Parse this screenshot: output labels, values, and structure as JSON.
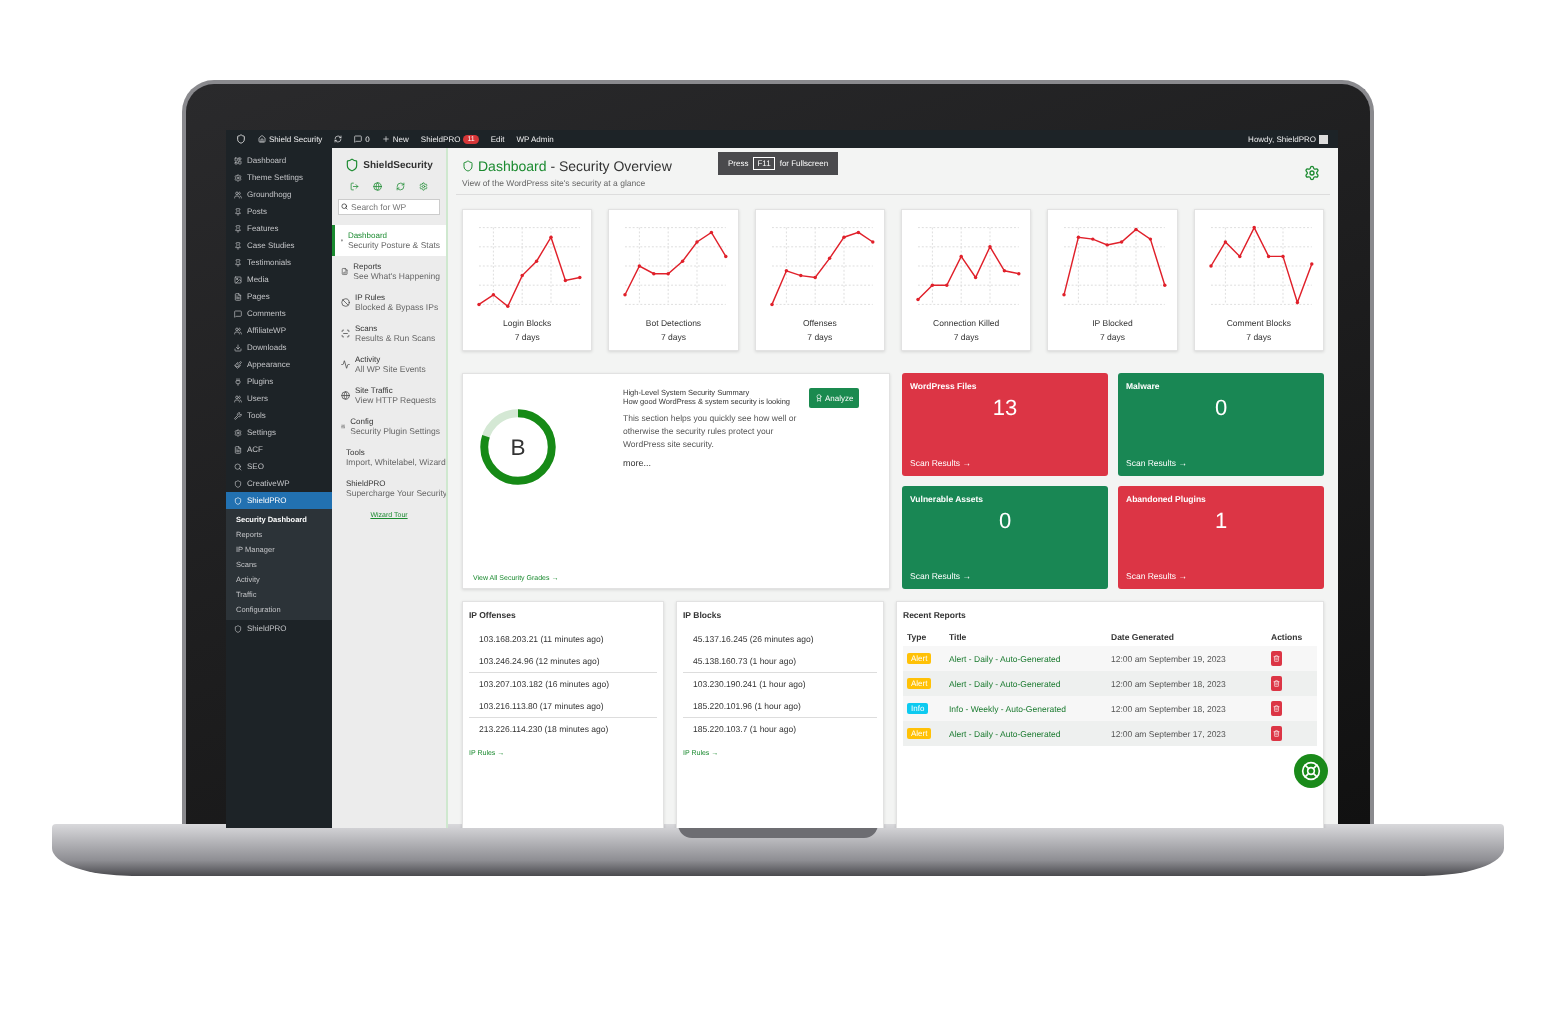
{
  "admin_bar": {
    "site": "Shield Security",
    "comments": "0",
    "new": "New",
    "plugin": "ShieldPRO",
    "plugin_badge": "11",
    "edit": "Edit",
    "admin": "WP Admin",
    "greeting": "Howdy, ShieldPRO"
  },
  "wp_menu": [
    {
      "label": "Dashboard",
      "selected": false
    },
    {
      "label": "Theme Settings",
      "selected": false
    },
    {
      "label": "Groundhogg",
      "selected": false
    },
    {
      "label": "Posts",
      "selected": false
    },
    {
      "label": "Features",
      "selected": false
    },
    {
      "label": "Case Studies",
      "selected": false
    },
    {
      "label": "Testimonials",
      "selected": false
    },
    {
      "label": "Media",
      "selected": false
    },
    {
      "label": "Pages",
      "selected": false
    },
    {
      "label": "Comments",
      "selected": false
    },
    {
      "label": "AffiliateWP",
      "selected": false
    },
    {
      "label": "Downloads",
      "selected": false
    },
    {
      "label": "Appearance",
      "selected": false
    },
    {
      "label": "Plugins",
      "selected": false
    },
    {
      "label": "Users",
      "selected": false
    },
    {
      "label": "Tools",
      "selected": false
    },
    {
      "label": "Settings",
      "selected": false
    },
    {
      "label": "ACF",
      "selected": false
    },
    {
      "label": "SEO",
      "selected": false
    },
    {
      "label": "CreativeWP",
      "selected": false
    },
    {
      "label": "ShieldPRO",
      "selected": true,
      "children": [
        {
          "label": "Security Dashboard",
          "selected": true
        },
        {
          "label": "Reports",
          "selected": false
        },
        {
          "label": "IP Manager",
          "selected": false
        },
        {
          "label": "Scans",
          "selected": false
        },
        {
          "label": "Activity",
          "selected": false
        },
        {
          "label": "Traffic",
          "selected": false
        },
        {
          "label": "Configuration",
          "selected": false
        }
      ]
    },
    {
      "label": "ShieldPRO",
      "selected": false
    }
  ],
  "shield_nav": {
    "logo": "ShieldSecurity",
    "search": {
      "placeholder": "Search for WP"
    },
    "items": [
      {
        "title": "Dashboard",
        "subtitle": "Security Posture & Stats",
        "selected": true
      },
      {
        "title": "Reports",
        "subtitle": "See What's Happening",
        "selected": false
      },
      {
        "title": "IP Rules",
        "subtitle": "Blocked & Bypass IPs",
        "selected": false
      },
      {
        "title": "Scans",
        "subtitle": "Results & Run Scans",
        "selected": false
      },
      {
        "title": "Activity",
        "subtitle": "All WP Site Events",
        "selected": false
      },
      {
        "title": "Site Traffic",
        "subtitle": "View HTTP Requests",
        "selected": false
      },
      {
        "title": "Config",
        "subtitle": "Security Plugin Settings",
        "selected": false
      },
      {
        "title": "Tools",
        "subtitle": "Import, Whitelabel, Wizard",
        "selected": false
      },
      {
        "title": "ShieldPRO",
        "subtitle": "Supercharge Your Security",
        "selected": false
      }
    ],
    "link": "Wizard Tour"
  },
  "header": {
    "title": "Dashboard",
    "title_rest": "- Security Overview",
    "subtitle": "View of the WordPress site's security at a glance",
    "hint": {
      "before": "Press",
      "key": "F11",
      "after": "for Fullscreen"
    }
  },
  "charts": [
    {
      "title": "Login Blocks",
      "period": "7 days"
    },
    {
      "title": "Bot Detections",
      "period": "7 days"
    },
    {
      "title": "Offenses",
      "period": "7 days"
    },
    {
      "title": "Connection Killed",
      "period": "7 days"
    },
    {
      "title": "IP Blocked",
      "period": "7 days"
    },
    {
      "title": "Comment Blocks",
      "period": "7 days"
    }
  ],
  "grade": {
    "grade": "B",
    "level": 0.8,
    "title": "High-Level System Security Summary",
    "subtitle": "How good WordPress & system security is looking",
    "text": "This section helps you quickly see how well or otherwise the security rules protect your WordPress site security.",
    "more": "more...",
    "button": "Analyze",
    "link": "View All Security Grades →"
  },
  "stats": [
    {
      "title": "WordPress Files",
      "value": "13",
      "color": "#dc3545",
      "link": "Scan Results →"
    },
    {
      "title": "Malware",
      "value": "0",
      "color": "#198754",
      "link": "Scan Results →"
    },
    {
      "title": "Vulnerable Assets",
      "value": "0",
      "color": "#198754",
      "link": "Scan Results →"
    },
    {
      "title": "Abandoned Plugins",
      "value": "1",
      "color": "#dc3545",
      "link": "Scan Results →"
    }
  ],
  "ip_lists": [
    {
      "title": "IP Offenses",
      "entries": [
        "103.168.203.21 (11 minutes ago)",
        "103.246.24.96 (12 minutes ago)",
        "103.207.103.182 (16 minutes ago)",
        "103.216.113.80 (17 minutes ago)",
        "213.226.114.230 (18 minutes ago)"
      ],
      "link": "IP Rules →"
    },
    {
      "title": "IP Blocks",
      "entries": [
        "45.137.16.245 (26 minutes ago)",
        "45.138.160.73 (1 hour ago)",
        "103.230.190.241 (1 hour ago)",
        "185.220.101.96 (1 hour ago)",
        "185.220.103.7 (1 hour ago)"
      ],
      "link": "IP Rules →"
    }
  ],
  "reports": {
    "title": "Recent Reports",
    "columns": [
      "Type",
      "Title",
      "Date Generated",
      "Actions"
    ],
    "rows": [
      {
        "type": "Alert",
        "kind": "alert",
        "title": "Alert - Daily - Auto-Generated",
        "date": "12:00 am September 19, 2023"
      },
      {
        "type": "Alert",
        "kind": "alert",
        "title": "Alert - Daily - Auto-Generated",
        "date": "12:00 am September 18, 2023"
      },
      {
        "type": "Info",
        "kind": "info",
        "title": "Info - Weekly - Auto-Generated",
        "date": "12:00 am September 18, 2023"
      },
      {
        "type": "Alert",
        "kind": "alert",
        "title": "Alert - Daily - Auto-Generated",
        "date": "12:00 am September 17, 2023"
      }
    ]
  }
}
